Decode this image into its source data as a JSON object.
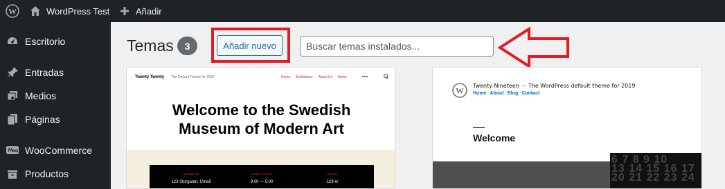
{
  "admin_bar": {
    "site_name": "WordPress Test",
    "new_label": "Añadir",
    "icons": [
      "wordpress-logo-icon",
      "home-icon",
      "plus-icon"
    ]
  },
  "sidebar": {
    "items": [
      {
        "label": "Escritorio",
        "icon": "dashboard-icon"
      },
      {
        "label": "Entradas",
        "icon": "pin-icon"
      },
      {
        "label": "Medios",
        "icon": "media-icon"
      },
      {
        "label": "Páginas",
        "icon": "pages-icon"
      },
      {
        "label": "WooCommerce",
        "icon": "woocommerce-icon"
      },
      {
        "label": "Productos",
        "icon": "products-icon"
      }
    ]
  },
  "page": {
    "title": "Temas",
    "count": "3",
    "add_new_label": "Añadir nuevo",
    "search_placeholder": "Buscar temas instalados..."
  },
  "annotations": {
    "highlight_color": "#e11c24"
  },
  "themes": [
    {
      "site_title": "Twenty Twenty",
      "description": "The Default Theme for 2020",
      "nav": [
        "Home",
        "Exhibitions",
        "About Us",
        "News"
      ],
      "menu_label": "Menu",
      "search_label": "Search",
      "hero_line1": "Welcome to the Swedish",
      "hero_line2": "Museum of Modern Art",
      "info": [
        {
          "label": "ADDRESS",
          "value": "123 Storgatan, Umeå"
        },
        {
          "label": "OPEN TODAY",
          "value": "9:00 — 5:00"
        },
        {
          "label": "PRICE",
          "value": "129 kr"
        }
      ]
    },
    {
      "site_title": "Twenty Nineteen",
      "separator": "—",
      "description": "The WordPress default theme for 2019",
      "nav": [
        "Home",
        "About",
        "Blog",
        "Contact"
      ],
      "heading": "Welcome",
      "calendar_rows": [
        "6  7  8  9 10",
        "13 14 15 16 17",
        "20 21 22 23 24"
      ]
    }
  ],
  "colors": {
    "admin_bg": "#1d2327",
    "primary": "#2271b1",
    "badge": "#646970",
    "t20_accent": "#cd2653",
    "t19_link": "#0073aa"
  }
}
